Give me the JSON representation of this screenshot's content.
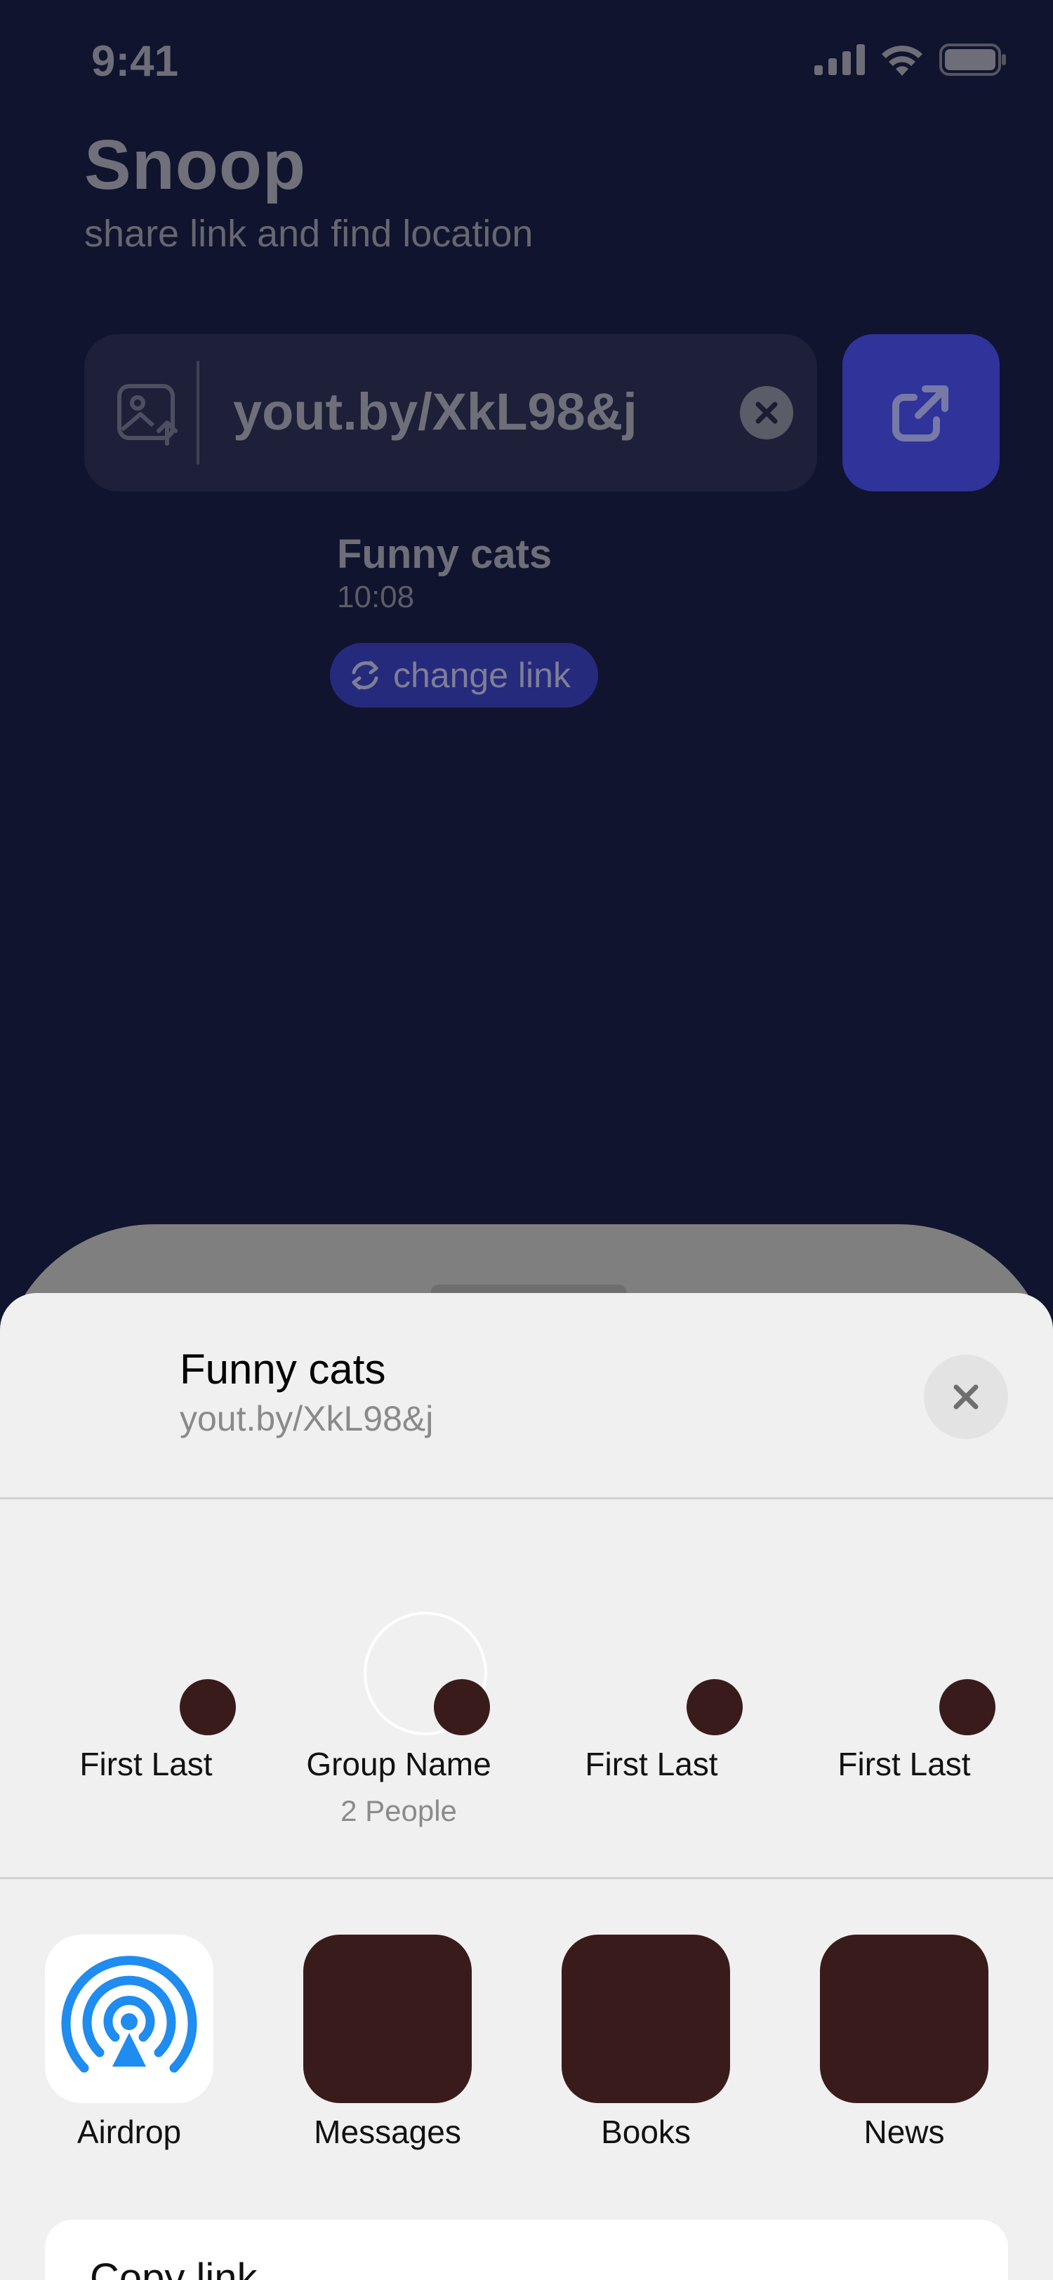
{
  "status": {
    "time": "9:41"
  },
  "app": {
    "title": "Snoop",
    "subtitle": "share link and find location"
  },
  "link_field": {
    "value": "yout.by/XkL98&j"
  },
  "video": {
    "title": "Funny cats",
    "time": "10:08",
    "change_link": "change link"
  },
  "sheet": {
    "title": "Funny cats",
    "url": "yout.by/XkL98&j",
    "contacts": [
      {
        "name": "First Last",
        "sub": ""
      },
      {
        "name": "Group Name",
        "sub": "2 People"
      },
      {
        "name": "First Last",
        "sub": ""
      },
      {
        "name": "First Last",
        "sub": ""
      }
    ],
    "apps": [
      {
        "label": "Airdrop",
        "icon": "airdrop-icon",
        "color": "#ffffff"
      },
      {
        "label": "Messages",
        "icon": "messages-icon",
        "color": "#3a1b1b"
      },
      {
        "label": "Books",
        "icon": "books-icon",
        "color": "#3a1b1b"
      },
      {
        "label": "News",
        "icon": "news-icon",
        "color": "#3a1b1b"
      }
    ],
    "copy_link": "Copy link"
  },
  "colors": {
    "background": "#10142e",
    "accent": "#2f339a",
    "sheet": "#f0f0f0",
    "airdrop_blue": "#1f8cf0"
  }
}
